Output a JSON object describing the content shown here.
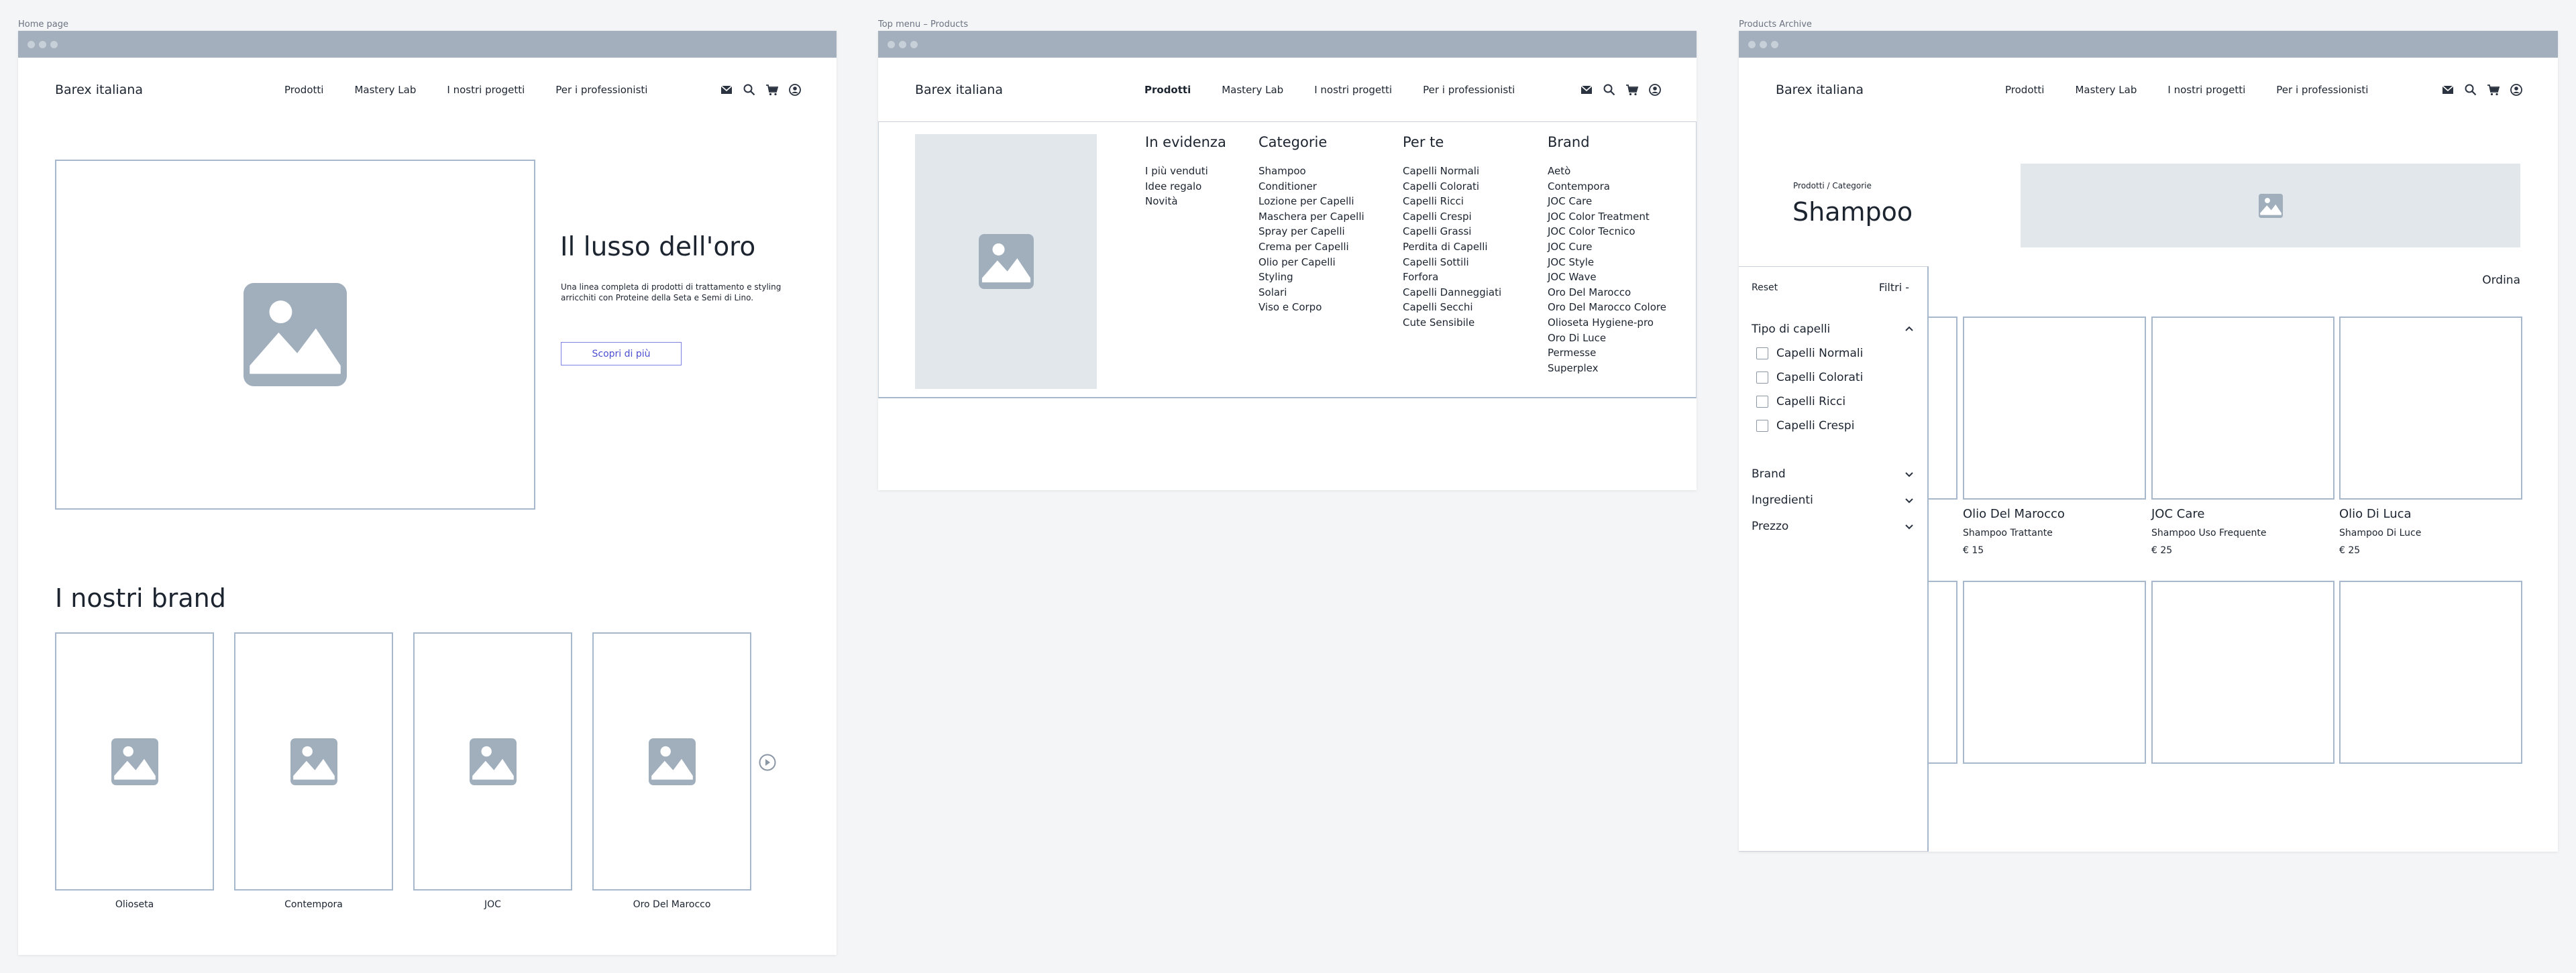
{
  "frames": {
    "home": "Home page",
    "menu": "Top menu – Products",
    "archive": "Products Archive"
  },
  "header": {
    "logo": "Barex italiana",
    "nav": [
      "Prodotti",
      "Mastery Lab",
      "I nostri progetti",
      "Per i professionisti"
    ]
  },
  "icons": [
    "mail-icon",
    "search-icon",
    "cart-icon",
    "user-icon"
  ],
  "home": {
    "hero_title": "Il lusso dell'oro",
    "hero_desc": "Una linea completa di prodotti di trattamento e styling arricchiti con Proteine della Seta e Semi di Lino.",
    "hero_button": "Scopri di più",
    "brands_title": "I nostri brand",
    "brands": [
      "Olioseta",
      "Contempora",
      "JOC",
      "Oro Del Marocco"
    ]
  },
  "menu": {
    "columns": [
      {
        "title": "In evidenza",
        "items": [
          "I più venduti",
          "Idee regalo",
          "Novità"
        ]
      },
      {
        "title": "Categorie",
        "items": [
          "Shampoo",
          "Conditioner",
          "Lozione per Capelli",
          "Maschera per Capelli",
          "Spray per Capelli",
          "Crema per Capelli",
          "Olio per Capelli",
          "Styling",
          "Solari",
          "Viso e Corpo"
        ]
      },
      {
        "title": "Per te",
        "items": [
          "Capelli Normali",
          "Capelli Colorati",
          "Capelli Ricci",
          "Capelli Crespi",
          "Capelli Grassi",
          "Perdita di Capelli",
          "Capelli Sottili",
          "Forfora",
          "Capelli Danneggiati",
          "Capelli Secchi",
          "Cute Sensibile"
        ]
      },
      {
        "title": "Brand",
        "items": [
          "Aetò",
          "Contempora",
          "JOC Care",
          "JOC Color Treatment",
          "JOC Color Tecnico",
          "JOC Cure",
          "JOC Style",
          "JOC Wave",
          "Oro Del Marocco",
          "Oro Del Marocco Colore",
          "Olioseta Hygiene-pro",
          "Oro Di Luce",
          "Permesse",
          "Superplex"
        ]
      }
    ]
  },
  "archive": {
    "breadcrumb": "Prodotti / Categorie",
    "title": "Shampoo",
    "sort": "Ordina",
    "filters": {
      "reset": "Reset",
      "toggle": "Filtri -",
      "hair_type_title": "Tipo di capelli",
      "hair_types": [
        "Capelli Normali",
        "Capelli Colorati",
        "Capelli Ricci",
        "Capelli Crespi"
      ],
      "sections": [
        "Brand",
        "Ingredienti",
        "Prezzo"
      ]
    },
    "products": [
      {
        "name": "Olio Del Marocco",
        "desc": "Shampoo Trattante",
        "price": "€ 15"
      },
      {
        "name": "JOC Care",
        "desc": "Shampoo Uso Frequente",
        "price": "€ 25"
      },
      {
        "name": "Olio Di Luca",
        "desc": "Shampoo Di Luce",
        "price": "€ 25"
      }
    ]
  }
}
